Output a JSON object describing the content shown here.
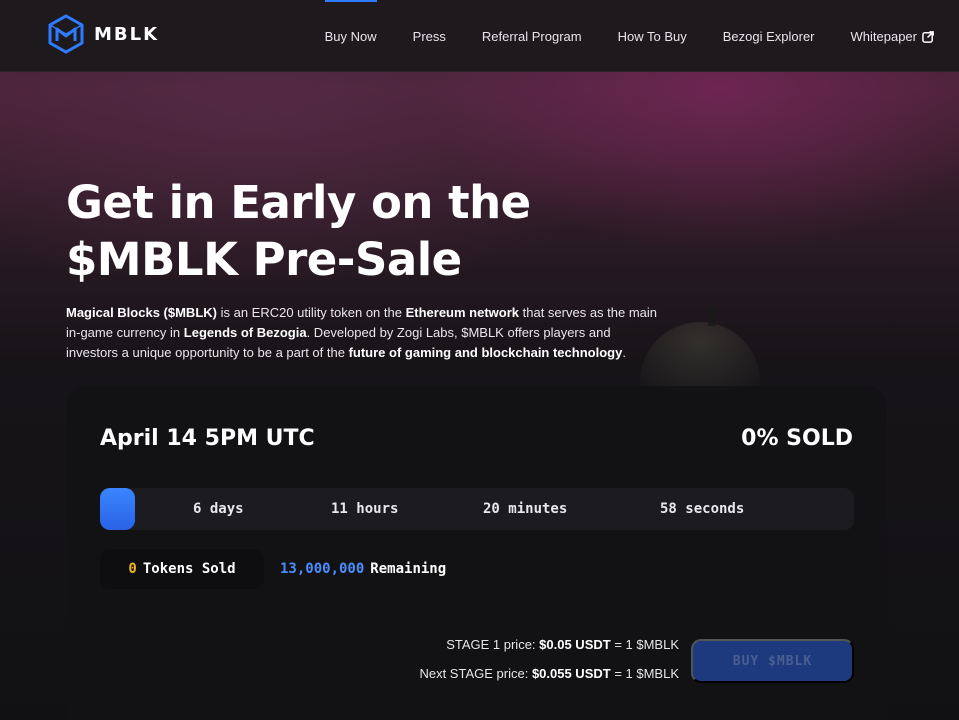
{
  "brand": {
    "name": "MBLK",
    "accent": "#2f7bff"
  },
  "nav": {
    "items": [
      {
        "label": "Buy Now"
      },
      {
        "label": "Press"
      },
      {
        "label": "Referral Program"
      },
      {
        "label": "How To Buy"
      },
      {
        "label": "Bezogi Explorer"
      },
      {
        "label": "Whitepaper",
        "icon": "external-link-icon"
      }
    ]
  },
  "hero": {
    "title_line1": "Get in Early on the",
    "title_line2": "$MBLK Pre-Sale",
    "desc": {
      "p1_bold": "Magical Blocks ($MBLK)",
      "p2": " is an ERC20 utility token on the ",
      "p3_bold": "Ethereum network",
      "p4": " that serves as the main in-game currency in ",
      "p5_bold": "Legends of Bezogia",
      "p6": ". Developed by Zogi Labs, $MBLK offers players and investors a unique opportunity to be a part of the ",
      "p7_bold": "future of gaming and blockchain technology",
      "p8": "."
    }
  },
  "sale": {
    "date": "April 14 5PM UTC",
    "sold_percent": "0% SOLD",
    "countdown": {
      "days": "6 days",
      "hours": "11 hours",
      "minutes": "20 minutes",
      "seconds": "58 seconds"
    },
    "tokens_sold_value": "0",
    "tokens_sold_label": "Tokens Sold",
    "remaining_value": "13,000,000",
    "remaining_label": "Remaining",
    "stage_price": {
      "prefix": "STAGE 1 price: ",
      "value": "$0.05 USDT",
      "suffix": " = 1 $MBLK"
    },
    "next_stage_price": {
      "prefix": "Next STAGE price: ",
      "value": "$0.055 USDT",
      "suffix": " = 1 $MBLK"
    },
    "buy_label": "BUY $MBLK",
    "colors": {
      "tokens_sold": "#f1b51c",
      "remaining": "#4b8dff",
      "button_bg": "#1d3a7e"
    }
  }
}
